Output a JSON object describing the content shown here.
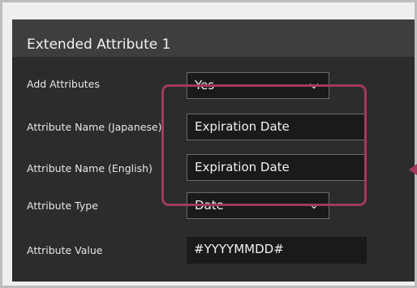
{
  "panel": {
    "title": "Extended Attribute 1"
  },
  "rows": [
    {
      "label": "Add Attributes",
      "value": "Yes",
      "kind": "select"
    },
    {
      "label": "Attribute Name (Japanese)",
      "value": "Expiration Date",
      "kind": "text"
    },
    {
      "label": "Attribute Name (English)",
      "value": "Expiration Date",
      "kind": "text"
    },
    {
      "label": "Attribute Type",
      "value": "Date",
      "kind": "select"
    },
    {
      "label": "Attribute Value",
      "value": "#YYYYMMDD#",
      "kind": "readonly"
    }
  ],
  "colors": {
    "highlight": "#a23a5e",
    "panel_bg": "#2c2c2c",
    "header_bg": "#3e3e3e",
    "field_bg": "#1a1a1a"
  },
  "icons": [
    "chevron-down-icon",
    "callout-arrow-icon"
  ]
}
